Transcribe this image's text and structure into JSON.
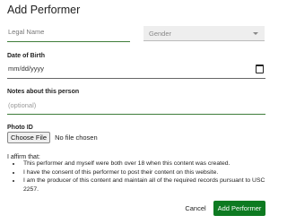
{
  "dialog": {
    "title": "Add Performer"
  },
  "form": {
    "legal_name_placeholder": "Legal Name",
    "gender_placeholder": "Gender",
    "dob_label": "Date of Birth",
    "dob_placeholder": "mm/dd/yyyy",
    "notes_label": "Notes about this person",
    "notes_placeholder": "(optional)",
    "photo_label": "Photo ID",
    "choose_file_label": "Choose File",
    "no_file_text": "No file chosen"
  },
  "affirmation": {
    "title": "I affirm that:",
    "items": [
      "This performer and myself were both over 18 when this content was created.",
      "I have the consent of this performer to post their content on this website.",
      "I am the producer of this content and maintain all of the required records pursuant to USC 2257."
    ]
  },
  "actions": {
    "cancel_label": "Cancel",
    "submit_label": "Add Performer"
  },
  "colors": {
    "accent_underline": "#3e7d3a",
    "submit_bg": "#0d7a21"
  }
}
